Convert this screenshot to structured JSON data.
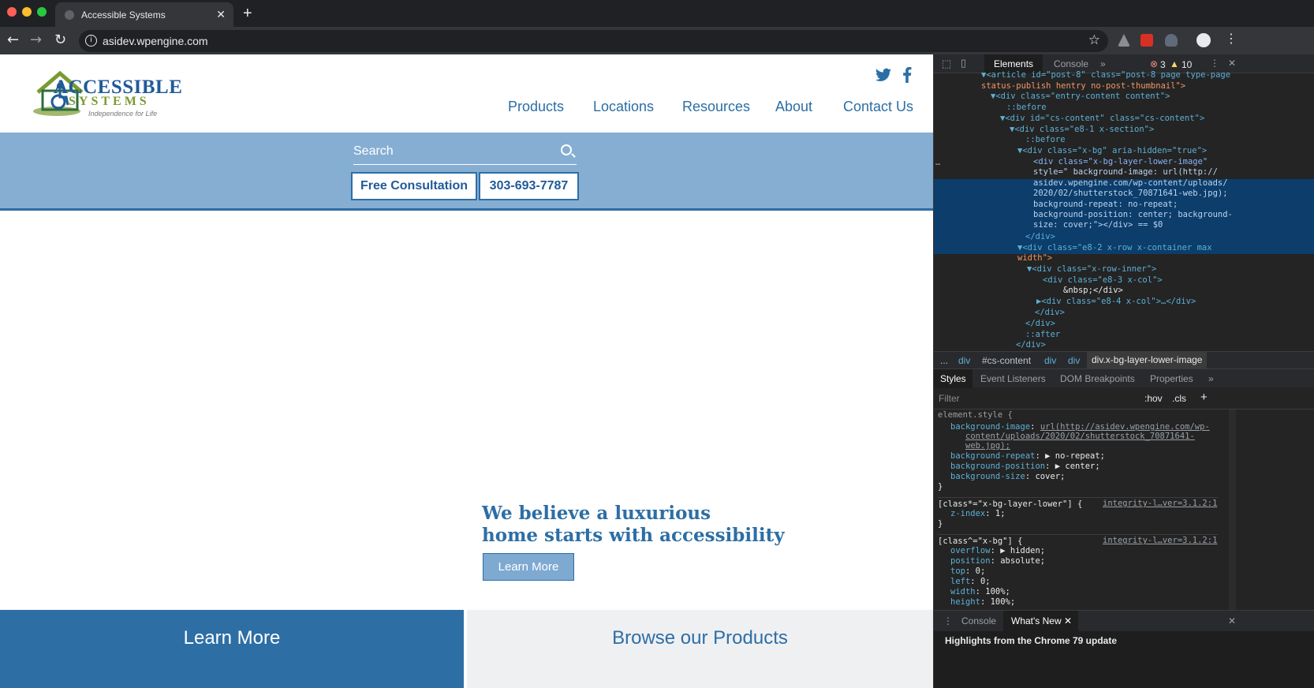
{
  "browser": {
    "tab_title": "Accessible Systems",
    "tab_close": "✕",
    "new_tab": "+",
    "url": "asidev.wpengine.com"
  },
  "site": {
    "logo": {
      "line1": "ACCESSIBLE",
      "line2": "SYSTEMS",
      "tagline": "Independence for Life"
    },
    "nav": [
      "Products",
      "Locations",
      "Resources",
      "About",
      "Contact Us"
    ],
    "search_placeholder": "Search",
    "consult_button": "Free Consultation",
    "phone_button": "303-693-7787",
    "hero": {
      "line1": "We believe a luxurious",
      "line2": "home starts with accessibility",
      "button": "Learn More"
    },
    "bottom": {
      "left": "Learn More",
      "right": "Browse our Products"
    }
  },
  "devtools": {
    "tabs": [
      "Elements",
      "Console",
      "»"
    ],
    "errors": "3",
    "warnings": "10",
    "code_lines": [
      "▼<article id=\"post-8\" class=\"post-8 page type-page",
      "status-publish hentry no-post-thumbnail\">",
      "▼<div class=\"entry-content content\">",
      "::before",
      "▼<div id=\"cs-content\" class=\"cs-content\">",
      "▼<div class=\"e8-1 x-section\">",
      "::before",
      "▼<div class=\"x-bg\" aria-hidden=\"true\">",
      "<div class=\"x-bg-layer-lower-image\"",
      "style=\" background-image: url(http://",
      "asidev.wpengine.com/wp-content/uploads/",
      "2020/02/shutterstock_70871641-web.jpg);",
      "background-repeat: no-repeat;",
      "background-position: center; background-",
      "size: cover;\"></div> == $0",
      "</div>",
      "▼<div class=\"e8-2 x-row x-container max",
      "width\">",
      "▼<div class=\"x-row-inner\">",
      "<div class=\"e8-3 x-col\">",
      "&nbsp;</div>",
      "▶<div class=\"e8-4 x-col\">…</div>",
      "</div>",
      "</div>",
      "::after",
      "</div>"
    ],
    "breadcrumbs": [
      "...",
      "div",
      "#cs-content",
      "div",
      "div",
      "div.x-bg-layer-lower-image"
    ],
    "style_tabs": [
      "Styles",
      "Event Listeners",
      "DOM Breakpoints",
      "Properties",
      "»"
    ],
    "filter_placeholder": "Filter",
    "filter_hov": ":hov",
    "filter_cls": ".cls",
    "filter_add": "+",
    "styles": {
      "element_style": "element.style {",
      "rule1_props": [
        [
          "background-image",
          "url(http://asidev.wpengine.com/wp-"
        ],
        [
          "",
          "content/uploads/2020/02/shutterstock_70871641-"
        ],
        [
          "",
          "web.jpg);"
        ],
        [
          "background-repeat",
          "▶ no-repeat;"
        ],
        [
          "background-position",
          "▶ center;"
        ],
        [
          "background-size",
          "cover;"
        ]
      ],
      "close_brace": "}",
      "rule2_selector": "[class*=\"x-bg-layer-lower\"] {",
      "rule2_source": "integrity-l…ver=3.1.2:1",
      "rule2_props": [
        [
          "z-index",
          "1;"
        ]
      ],
      "rule3_selector": "[class^=\"x-bg\"] {",
      "rule3_source": "integrity-l…ver=3.1.2:1",
      "rule3_props": [
        [
          "overflow",
          "▶ hidden;"
        ],
        [
          "position",
          "absolute;"
        ],
        [
          "top",
          "0;"
        ],
        [
          "left",
          "0;"
        ],
        [
          "width",
          "100%;"
        ],
        [
          "height",
          "100%;"
        ]
      ]
    },
    "drawer_tabs": [
      "Console",
      "What's New"
    ],
    "drawer_close": "✕",
    "drawer_text": "Highlights from the Chrome 79 update"
  }
}
